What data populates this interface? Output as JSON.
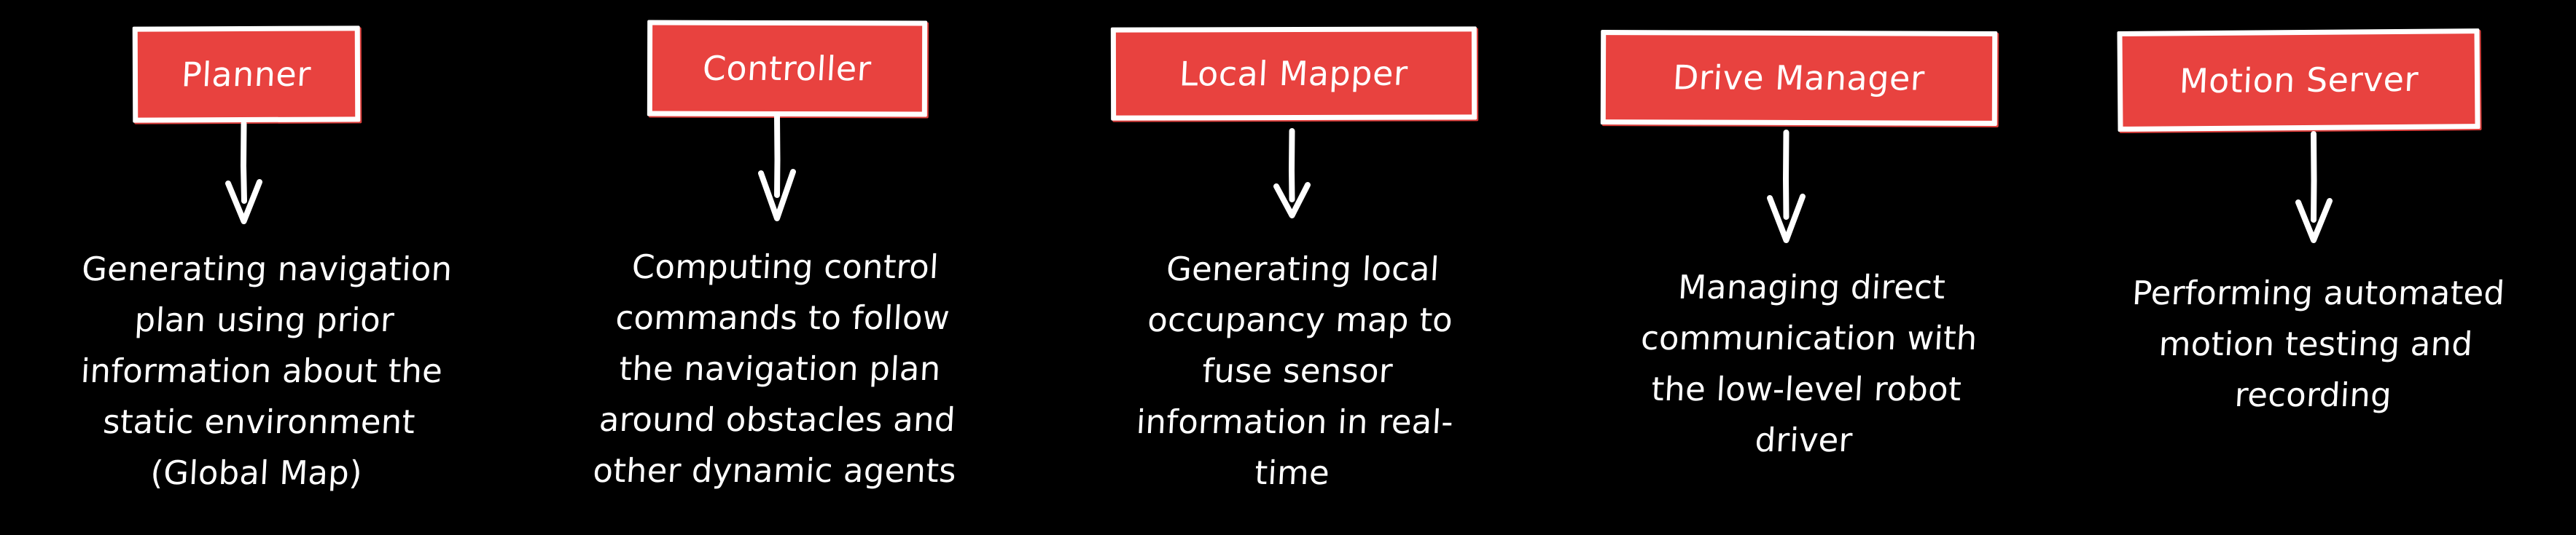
{
  "background_color": "#000000",
  "accent_color": "#e8423f",
  "text_color": "#ffffff",
  "diagram": {
    "type": "flow-columns",
    "columns": [
      {
        "id": "planner",
        "box_label": "Planner",
        "arrow": "down-arrow-icon",
        "description_lines": [
          "Generating navigation",
          "plan using prior",
          "information about the",
          "static environment",
          "(Global Map)"
        ],
        "description": "Generating navigation plan using prior information about the static environment (Global Map)"
      },
      {
        "id": "controller",
        "box_label": "Controller",
        "arrow": "down-arrow-icon",
        "description_lines": [
          "Computing control",
          "commands to follow",
          "the navigation plan",
          "around obstacles and",
          "other dynamic agents"
        ],
        "description": "Computing control commands to follow the navigation plan around obstacles and other dynamic agents"
      },
      {
        "id": "local-mapper",
        "box_label": "Local Mapper",
        "arrow": "down-arrow-icon",
        "description_lines": [
          "Generating local",
          "occupancy map to",
          "fuse sensor",
          "information in real-",
          "time"
        ],
        "description": "Generating local occupancy map to fuse sensor information in real-time"
      },
      {
        "id": "drive-manager",
        "box_label": "Drive Manager",
        "arrow": "down-arrow-icon",
        "description_lines": [
          "Managing direct",
          "communication with",
          "the low-level robot",
          "driver"
        ],
        "description": "Managing direct communication with the low-level robot driver"
      },
      {
        "id": "motion-server",
        "box_label": "Motion Server",
        "arrow": "down-arrow-icon",
        "description_lines": [
          "Performing automated",
          "motion testing and",
          "recording"
        ],
        "description": "Performing automated motion testing and recording"
      }
    ]
  }
}
